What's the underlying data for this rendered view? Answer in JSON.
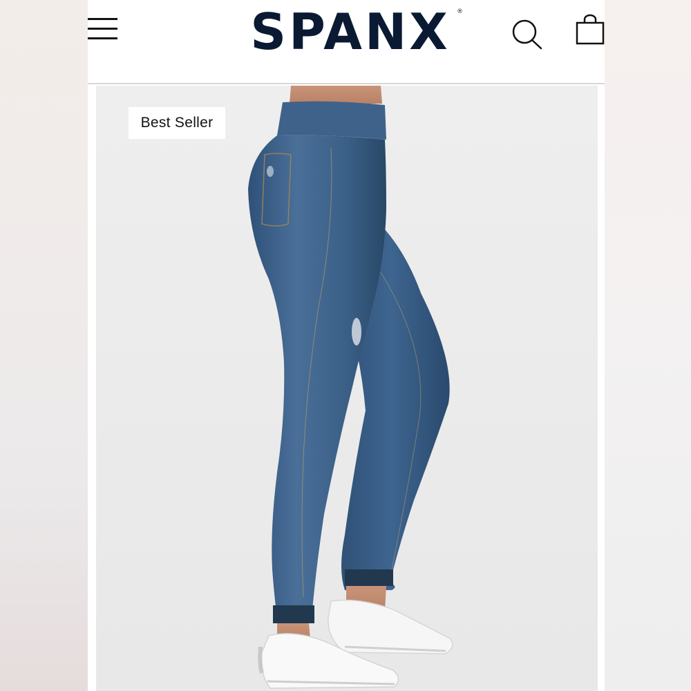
{
  "header": {
    "logo_text": "SPANX",
    "logo_mark": "®",
    "icons": {
      "menu": "hamburger-menu-icon",
      "search": "search-icon",
      "bag": "shopping-bag-icon"
    }
  },
  "product": {
    "badge": "Best Seller",
    "image_subject": "distressed-skinny-jeans-side-view"
  },
  "colors": {
    "brand_navy": "#0b1a33",
    "denim": "#3a5f88",
    "background": "#ececec"
  }
}
